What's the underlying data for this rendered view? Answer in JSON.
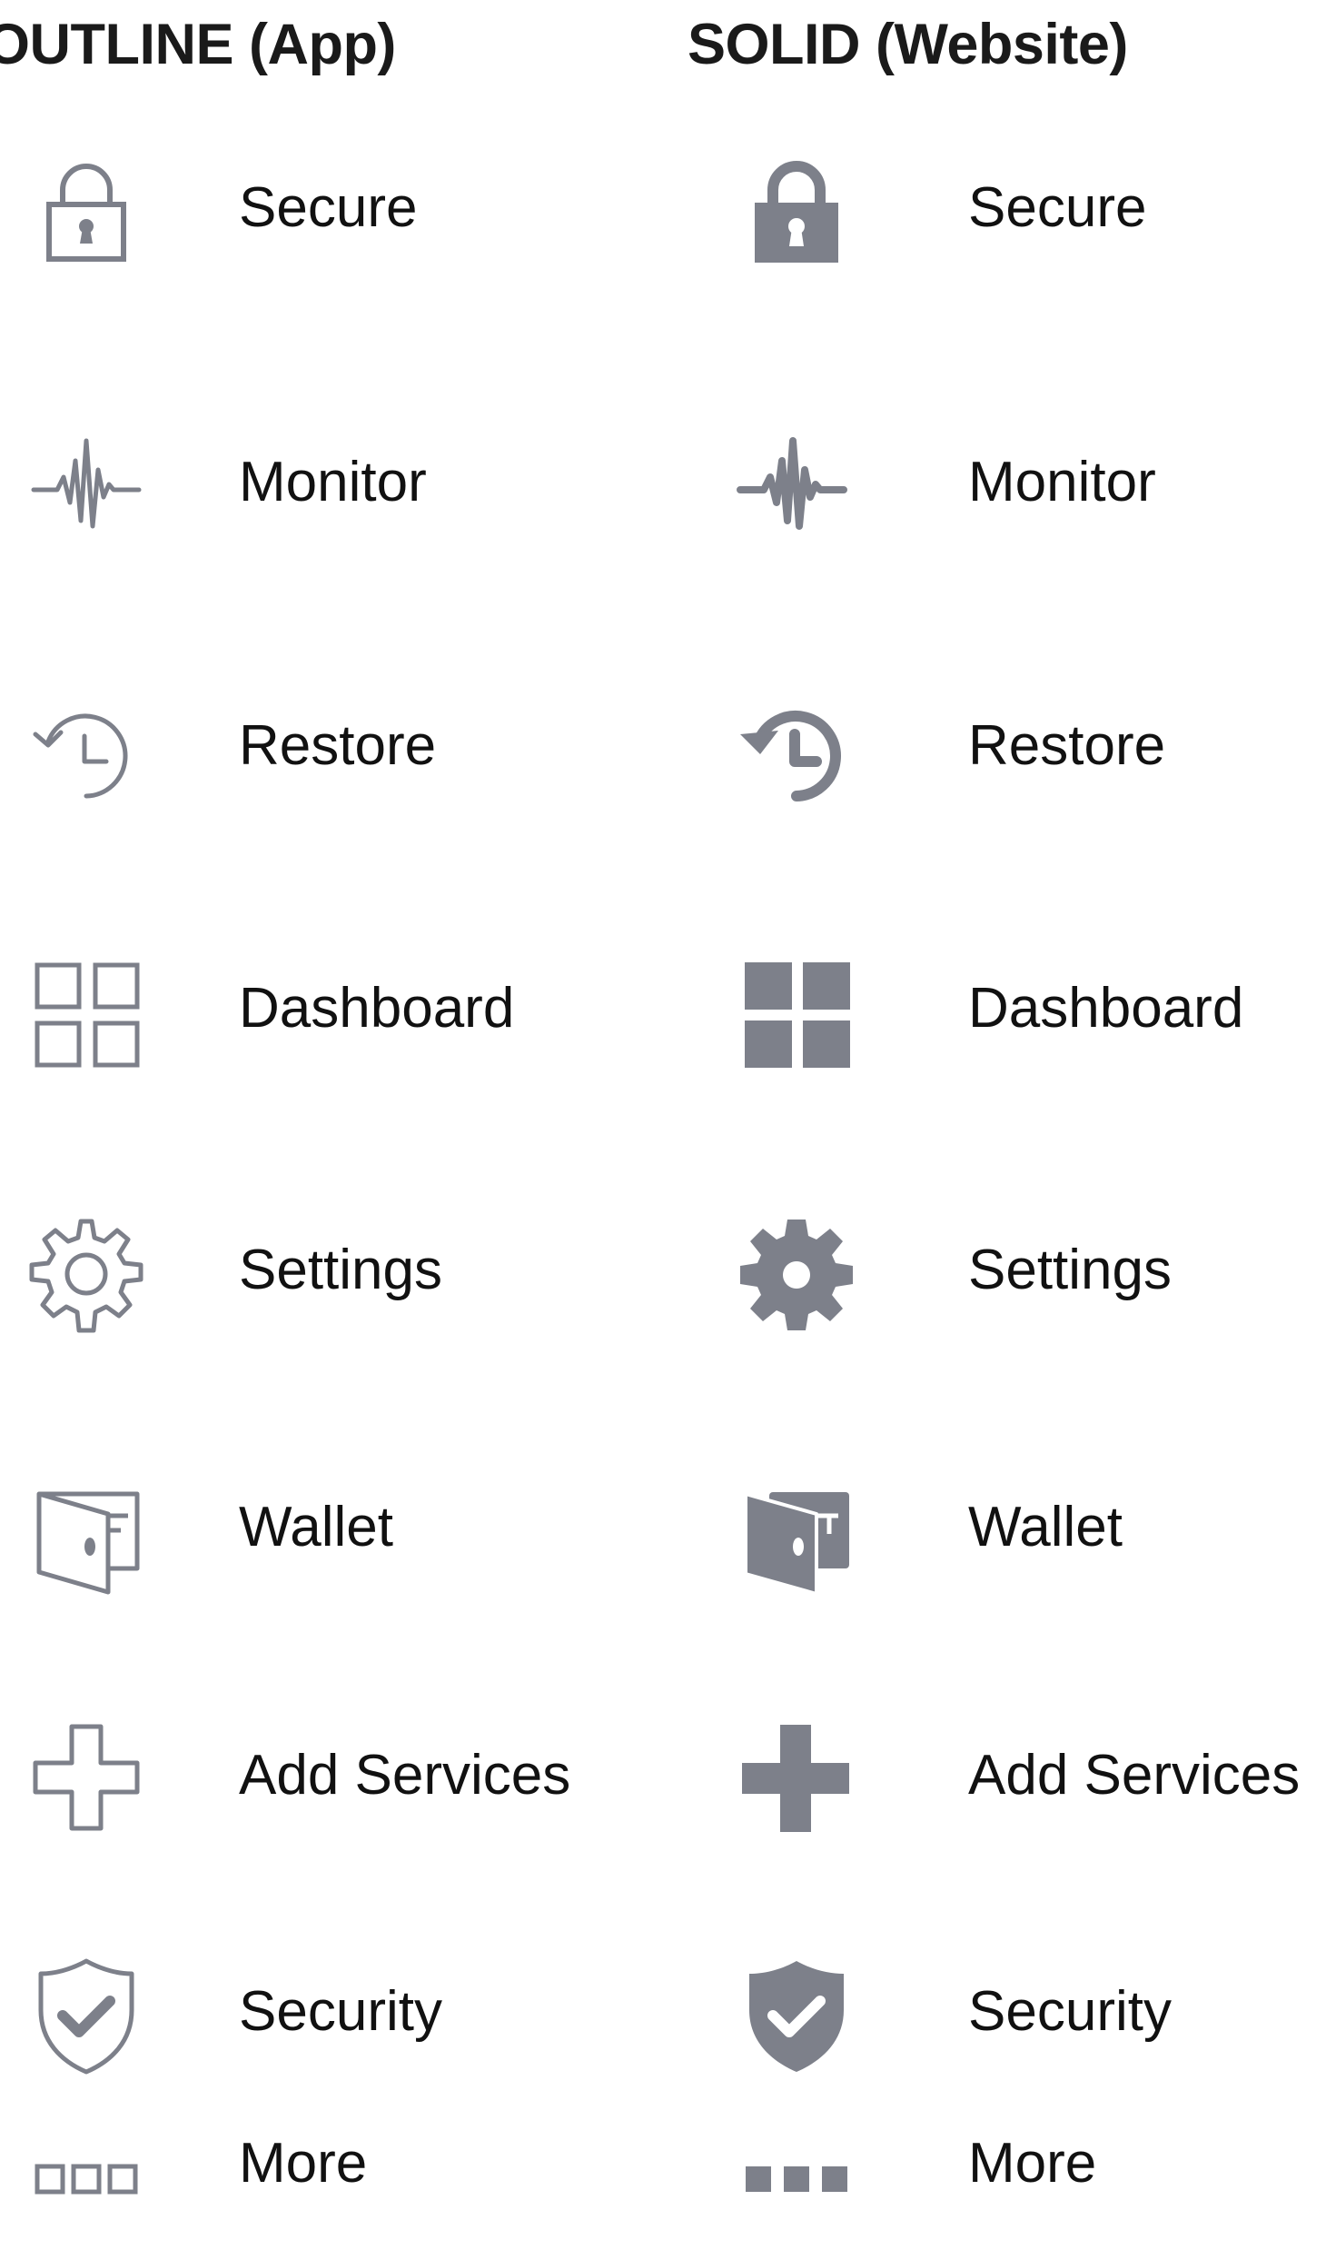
{
  "headers": {
    "outline": "OUTLINE (App)",
    "solid": "SOLID (Website)"
  },
  "icon_color": "#7d808a",
  "rows": [
    {
      "label": "Secure",
      "icon": "lock-icon"
    },
    {
      "label": "Monitor",
      "icon": "pulse-icon"
    },
    {
      "label": "Restore",
      "icon": "history-icon"
    },
    {
      "label": "Dashboard",
      "icon": "grid-icon"
    },
    {
      "label": "Settings",
      "icon": "gear-icon"
    },
    {
      "label": "Wallet",
      "icon": "wallet-icon"
    },
    {
      "label": "Add Services",
      "icon": "plus-icon"
    },
    {
      "label": "Security",
      "icon": "shield-check-icon"
    },
    {
      "label": "More",
      "icon": "more-icon"
    }
  ]
}
